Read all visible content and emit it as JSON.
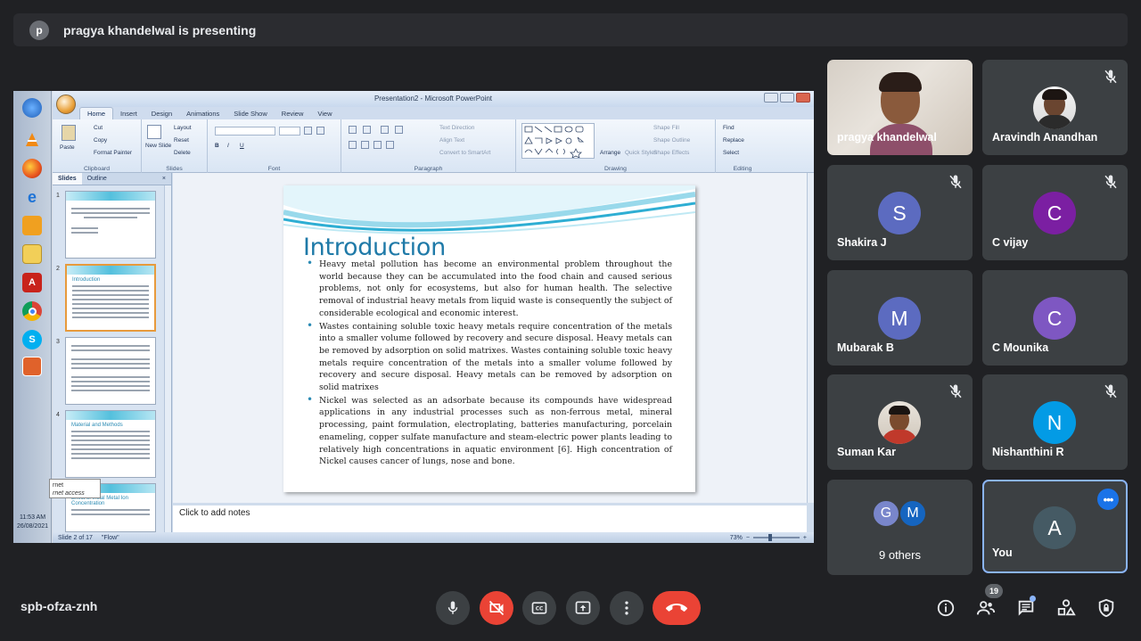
{
  "banner": {
    "avatar_letter": "p",
    "text": "pragya khandelwal is presenting"
  },
  "shared_screen": {
    "window_title": "Presentation2 - Microsoft PowerPoint",
    "ribbon_tabs": [
      "Home",
      "Insert",
      "Design",
      "Animations",
      "Slide Show",
      "Review",
      "View"
    ],
    "ribbon": {
      "paste": "Paste",
      "cut": "Cut",
      "copy": "Copy",
      "format_painter": "Format Painter",
      "clipboard": "Clipboard",
      "new_slide": "New Slide",
      "layout": "Layout",
      "reset": "Reset",
      "delete": "Delete",
      "slides": "Slides",
      "font": "Font",
      "text_direction": "Text Direction",
      "align_text": "Align Text",
      "convert_smartart": "Convert to SmartArt",
      "paragraph": "Paragraph",
      "arrange": "Arrange",
      "quick_styles": "Quick Styles",
      "shape_fill": "Shape Fill",
      "shape_outline": "Shape Outline",
      "shape_effects": "Shape Effects",
      "drawing": "Drawing",
      "find": "Find",
      "replace": "Replace",
      "select": "Select",
      "editing": "Editing"
    },
    "pane_tabs": [
      "Slides",
      "Outline"
    ],
    "thumb_numbers": [
      "1",
      "2",
      "3",
      "4",
      "5"
    ],
    "thumb_titles": [
      "Introduction",
      "Material and Methods",
      "Effect of Initial Metal Ion Concentration"
    ],
    "slide": {
      "title": "Introduction",
      "bullets": [
        "Heavy metal pollution has become an environmental problem throughout the world because they can be accumulated into the food chain and caused serious problems, not only for ecosystems, but also for human health. The selective removal of industrial heavy metals from liquid waste is consequently the subject of considerable ecological and economic interest.",
        "Wastes containing soluble toxic heavy metals require concentration of the metals into a smaller volume followed by recovery and secure disposal. Heavy metals can be removed by adsorption on solid matrixes. Wastes containing soluble toxic heavy metals require concentration of the metals into a smaller volume followed by recovery and secure disposal. Heavy metals can be removed by adsorption on solid matrixes",
        "Nickel was selected as an adsorbate because its compounds have widespread applications in any industrial processes such as non-ferrous metal, mineral processing, paint formulation, electroplating, batteries manufacturing, porcelain enameling, copper sulfate manufacture and steam-electric power plants leading to relatively high concentrations in aquatic environment [6]. High concentration of Nickel causes cancer of lungs, nose and bone."
      ]
    },
    "notes_placeholder": "Click to add notes",
    "status": {
      "slide_of": "Slide 2 of 17",
      "theme": "\"Flow\"",
      "zoom": "73%",
      "zoom_level": 0.73
    },
    "taskbar": {
      "time": "11:53 AM",
      "date": "26/08/2021",
      "tooltip_line1": "rnet",
      "tooltip_line2": "rnet access"
    }
  },
  "participants": [
    {
      "name": "pragya khandelwal",
      "type": "video"
    },
    {
      "name": "Aravindh Anandhan",
      "type": "photo",
      "muted": true
    },
    {
      "name": "Shakira J",
      "letter": "S",
      "color": "#5c6bc0",
      "muted": true
    },
    {
      "name": "C vijay",
      "letter": "C",
      "color": "#7b1fa2",
      "muted": true
    },
    {
      "name": "Mubarak B",
      "letter": "M",
      "color": "#5c6bc0"
    },
    {
      "name": "C Mounika",
      "letter": "C",
      "color": "#7e57c2"
    },
    {
      "name": "Suman Kar",
      "type": "photo",
      "muted": true
    },
    {
      "name": "Nishanthini R",
      "letter": "N",
      "color": "#039be5",
      "muted": true
    },
    {
      "name": "9 others",
      "type": "others",
      "letters": [
        "G",
        "M"
      ],
      "colors": [
        "#7986cb",
        "#1565c0"
      ]
    },
    {
      "name": "You",
      "letter": "A",
      "color": "#455a64",
      "self": true
    }
  ],
  "bottom_bar": {
    "meeting_code": "spb-ofza-znh",
    "people_count": "19"
  }
}
